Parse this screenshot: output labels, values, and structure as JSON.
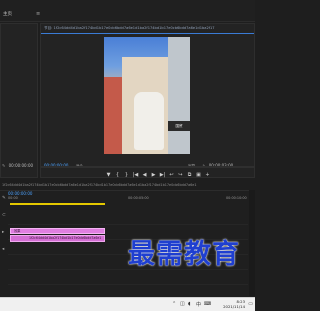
{
  "topbar": {
    "tab1": "主页",
    "tab2": "≡",
    "program_title": "节目: 1f2c64dd4-d1ba2f174bd1-b17e0cb6bdd7a6e1"
  },
  "program": {
    "header": "节目: 1f2c64dd4d1ba2f174bd1b17e0cb6bdd7a6e1d1ba2f174bd1b17e0cb6bdd7a6e1d1ba2f17",
    "timecode_left": "00:00:00:00",
    "fit_label": "适合",
    "full_label": "完整",
    "timecode_right": "00:00:03:00",
    "sign_text": "国贸"
  },
  "source": {
    "timecode": "00:00:00:00"
  },
  "info_strip": "1f2c64dd4d1ba2f174bd1b17e0cb6bdd7a6e1d1ba2f174bd1b17e0cb6bdd7a6e1d1ba2f174bd1b17e0cb6bdd7a6e1",
  "timeline": {
    "timecode": "00:00:00:00",
    "ruler": [
      "00:00",
      "00:00:05:00",
      "00:00:10:00"
    ],
    "video_clip_label": "效果",
    "audio_clip_label": "1f2c64dd4d1ba2f174bd1b17e0cb6bdd7a6e1"
  },
  "transport": [
    "▼",
    "{",
    "}",
    "|◀",
    "◀",
    "▶",
    "▶|",
    "↩",
    "↪",
    "⧉",
    "▣",
    "+"
  ],
  "watermark": "最需教育",
  "taskbar": {
    "time": "8:23",
    "date": "2021/11/14"
  }
}
